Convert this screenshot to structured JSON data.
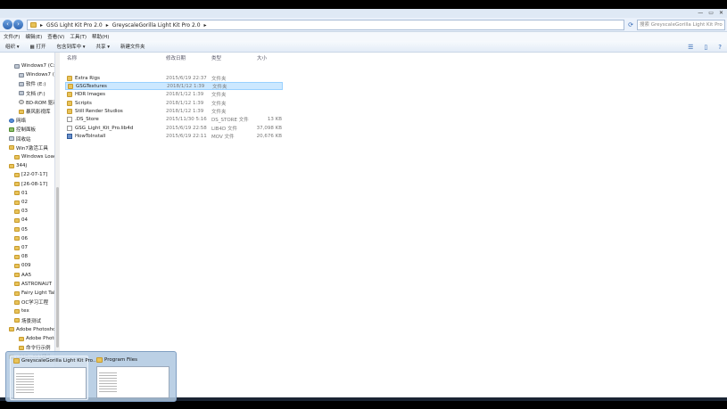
{
  "address": {
    "crumbs": [
      "GSG Light Kit Pro 2.0",
      "GreyscaleGorilla Light Kit Pro 2.0"
    ],
    "search_placeholder": "搜索 GreyscaleGorilla Light Kit Pro 2.0"
  },
  "menu": [
    "文件(F)",
    "编辑(E)",
    "查看(V)",
    "工具(T)",
    "帮助(H)"
  ],
  "toolbar": {
    "organize": "组织 ▾",
    "open": "打开",
    "include": "包含到库中 ▾",
    "share": "共享 ▾",
    "new_folder": "新建文件夹"
  },
  "nav": [
    {
      "label": "Windows7 (C:)",
      "icon": "drive"
    },
    {
      "label": "Windows7 (D:)",
      "icon": "drive"
    },
    {
      "label": "软件 (E:)",
      "icon": "drive"
    },
    {
      "label": "文档 (F:)",
      "icon": "drive"
    },
    {
      "label": "BD-ROM 驱动器",
      "icon": "disc"
    },
    {
      "label": "暴风影视库",
      "icon": "folder"
    },
    {
      "label": "网络",
      "icon": "net"
    },
    {
      "label": "控制面板",
      "icon": "panel"
    },
    {
      "label": "回收站",
      "icon": "bin"
    },
    {
      "label": "Win7激活工具",
      "icon": "folder"
    },
    {
      "label": "Windows Loader",
      "icon": "folder"
    },
    {
      "label": "344j",
      "icon": "folder"
    },
    {
      "label": "[22-07-17]",
      "icon": "folder"
    },
    {
      "label": "[26-08-17]",
      "icon": "folder"
    },
    {
      "label": "01",
      "icon": "folder"
    },
    {
      "label": "02",
      "icon": "folder"
    },
    {
      "label": "03",
      "icon": "folder"
    },
    {
      "label": "04",
      "icon": "folder"
    },
    {
      "label": "05",
      "icon": "folder"
    },
    {
      "label": "06",
      "icon": "folder"
    },
    {
      "label": "07",
      "icon": "folder"
    },
    {
      "label": "08",
      "icon": "folder"
    },
    {
      "label": "009",
      "icon": "folder"
    },
    {
      "label": "AA5",
      "icon": "folder"
    },
    {
      "label": "ASTRONAUT",
      "icon": "folder"
    },
    {
      "label": "Fairy Light Tale",
      "icon": "folder"
    },
    {
      "label": "OC学习工程",
      "icon": "folder"
    },
    {
      "label": "tex",
      "icon": "folder"
    },
    {
      "label": "场景测试",
      "icon": "folder"
    },
    {
      "label": "Adobe Photoshop",
      "icon": "folder"
    },
    {
      "label": "Adobe Photoshop",
      "icon": "folder"
    },
    {
      "label": "命令行示例",
      "icon": "folder"
    },
    {
      "label": "c010-c011镜头",
      "icon": "folder"
    }
  ],
  "columns": {
    "name": "名称",
    "date": "修改日期",
    "type": "类型",
    "size": "大小"
  },
  "files": [
    {
      "name": "Extra Rigs",
      "date": "2015/6/19 22:37",
      "type": "文件夹",
      "size": "",
      "icon": "folder",
      "selected": false
    },
    {
      "name": "GSGTextures",
      "date": "2018/1/12 1:39",
      "type": "文件夹",
      "size": "",
      "icon": "folder",
      "selected": true
    },
    {
      "name": "HDR Images",
      "date": "2018/1/12 1:39",
      "type": "文件夹",
      "size": "",
      "icon": "folder",
      "selected": false
    },
    {
      "name": "Scripts",
      "date": "2018/1/12 1:39",
      "type": "文件夹",
      "size": "",
      "icon": "folder",
      "selected": false
    },
    {
      "name": "Still Render Studios",
      "date": "2018/1/12 1:39",
      "type": "文件夹",
      "size": "",
      "icon": "folder",
      "selected": false
    },
    {
      "name": ".DS_Store",
      "date": "2015/11/30 5:16",
      "type": "DS_STORE 文件",
      "size": "13 KB",
      "icon": "doc",
      "selected": false
    },
    {
      "name": "GSG_Light_Kit_Pro.lib4d",
      "date": "2015/6/19 22:58",
      "type": "LIB4D 文件",
      "size": "37,098 KB",
      "icon": "doc",
      "selected": false
    },
    {
      "name": "HowToInstall",
      "date": "2015/6/19 22:11",
      "type": "MOV 文件",
      "size": "20,676 KB",
      "icon": "movie",
      "selected": false
    }
  ],
  "taskbar": {
    "thumbs": [
      {
        "title": "GreyscaleGorilla Light Kit Pro...",
        "active": true
      },
      {
        "title": "Program Files",
        "active": false
      }
    ]
  }
}
